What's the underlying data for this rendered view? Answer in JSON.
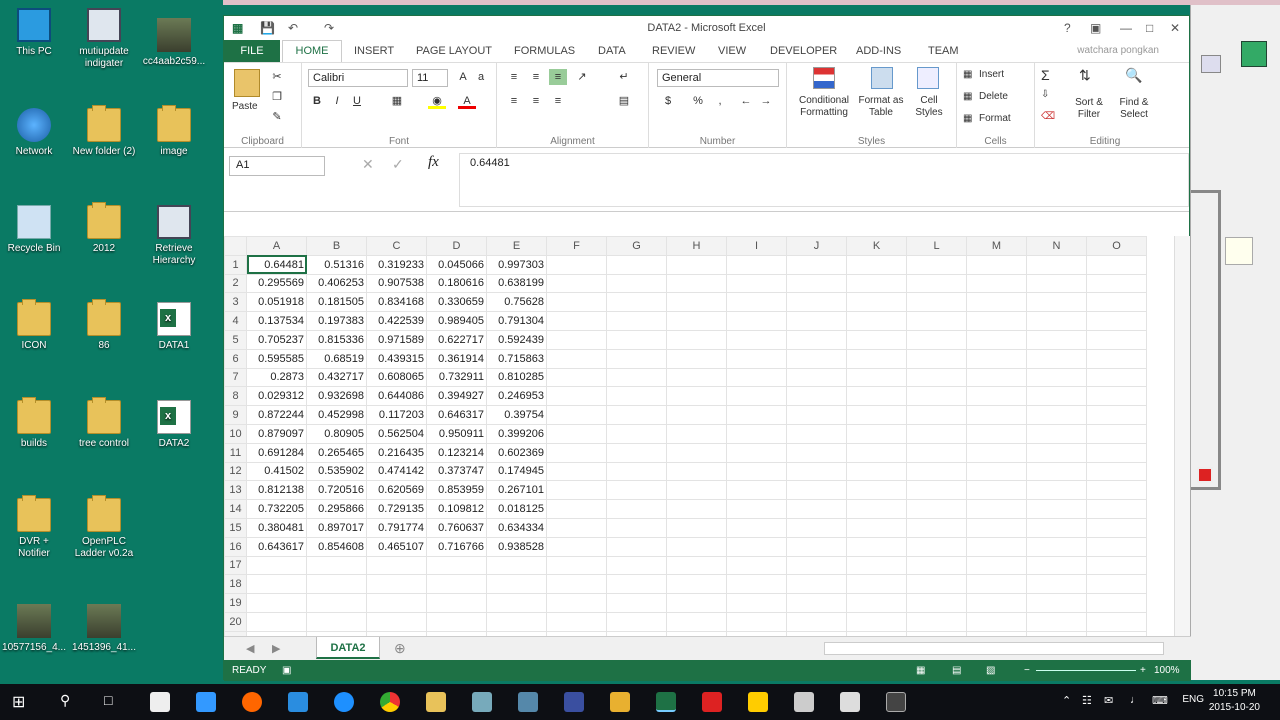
{
  "desktop": {
    "icons": [
      {
        "label": "This PC",
        "kind": "pc"
      },
      {
        "label": "mutiupdate indigater",
        "kind": "monitor"
      },
      {
        "label": "cc4aab2c59...",
        "kind": "photo"
      },
      {
        "label": "Network",
        "kind": "net"
      },
      {
        "label": "New folder (2)",
        "kind": "folder"
      },
      {
        "label": "image",
        "kind": "folder"
      },
      {
        "label": "Recycle Bin",
        "kind": "bin"
      },
      {
        "label": "2012",
        "kind": "folder"
      },
      {
        "label": "Retrieve Hierarchy",
        "kind": "monitor"
      },
      {
        "label": "ICON",
        "kind": "folder"
      },
      {
        "label": "86",
        "kind": "folder"
      },
      {
        "label": "DATA1",
        "kind": "xl"
      },
      {
        "label": "builds",
        "kind": "folder"
      },
      {
        "label": "tree control",
        "kind": "folder"
      },
      {
        "label": "DATA2",
        "kind": "xl"
      },
      {
        "label": "DVR + Notifier",
        "kind": "folder"
      },
      {
        "label": "OpenPLC Ladder v0.2a",
        "kind": "folder"
      },
      {
        "label": "10577156_4...",
        "kind": "photo"
      },
      {
        "label": "1451396_41...",
        "kind": "photo"
      }
    ]
  },
  "excel": {
    "title": "DATA2 - Microsoft Excel",
    "help": "?",
    "tabs": [
      "FILE",
      "HOME",
      "INSERT",
      "PAGE LAYOUT",
      "FORMULAS",
      "DATA",
      "REVIEW",
      "VIEW",
      "DEVELOPER",
      "ADD-INS",
      "TEAM"
    ],
    "user": "watchara pongkan",
    "ribbon": {
      "paste": "Paste",
      "clipboard": "Clipboard",
      "font_name": "Calibri",
      "font_size": "11",
      "font": "Font",
      "alignment": "Alignment",
      "number_format": "General",
      "number": "Number",
      "conditional": "Conditional Formatting",
      "format_table": "Format as Table",
      "cell_styles": "Cell Styles",
      "styles": "Styles",
      "insert": "Insert",
      "delete": "Delete",
      "format": "Format",
      "cells": "Cells",
      "sort": "Sort & Filter",
      "find": "Find & Select",
      "editing": "Editing"
    },
    "name_box": "A1",
    "formula_value": "0.64481",
    "columns": [
      "A",
      "B",
      "C",
      "D",
      "E",
      "F",
      "G",
      "H",
      "I",
      "J",
      "K",
      "L",
      "M",
      "N",
      "O"
    ],
    "rows": [
      [
        "0.64481",
        "0.51316",
        "0.319233",
        "0.045066",
        "0.997303"
      ],
      [
        "0.295569",
        "0.406253",
        "0.907538",
        "0.180616",
        "0.638199"
      ],
      [
        "0.051918",
        "0.181505",
        "0.834168",
        "0.330659",
        "0.75628"
      ],
      [
        "0.137534",
        "0.197383",
        "0.422539",
        "0.989405",
        "0.791304"
      ],
      [
        "0.705237",
        "0.815336",
        "0.971589",
        "0.622717",
        "0.592439"
      ],
      [
        "0.595585",
        "0.68519",
        "0.439315",
        "0.361914",
        "0.715863"
      ],
      [
        "0.2873",
        "0.432717",
        "0.608065",
        "0.732911",
        "0.810285"
      ],
      [
        "0.029312",
        "0.932698",
        "0.644086",
        "0.394927",
        "0.246953"
      ],
      [
        "0.872244",
        "0.452998",
        "0.117203",
        "0.646317",
        "0.39754"
      ],
      [
        "0.879097",
        "0.80905",
        "0.562504",
        "0.950911",
        "0.399206"
      ],
      [
        "0.691284",
        "0.265465",
        "0.216435",
        "0.123214",
        "0.602369"
      ],
      [
        "0.41502",
        "0.535902",
        "0.474142",
        "0.373747",
        "0.174945"
      ],
      [
        "0.812138",
        "0.720516",
        "0.620569",
        "0.853959",
        "0.267101"
      ],
      [
        "0.732205",
        "0.295866",
        "0.729135",
        "0.109812",
        "0.018125"
      ],
      [
        "0.380481",
        "0.897017",
        "0.791774",
        "0.760637",
        "0.634334"
      ],
      [
        "0.643617",
        "0.854608",
        "0.465107",
        "0.716766",
        "0.938528"
      ]
    ],
    "total_rows": 21,
    "sheet_tab": "DATA2",
    "status": "READY",
    "zoom": "100%"
  },
  "taskbar": {
    "lang": "ENG",
    "time": "10:15 PM",
    "date": "2015-10-20"
  }
}
